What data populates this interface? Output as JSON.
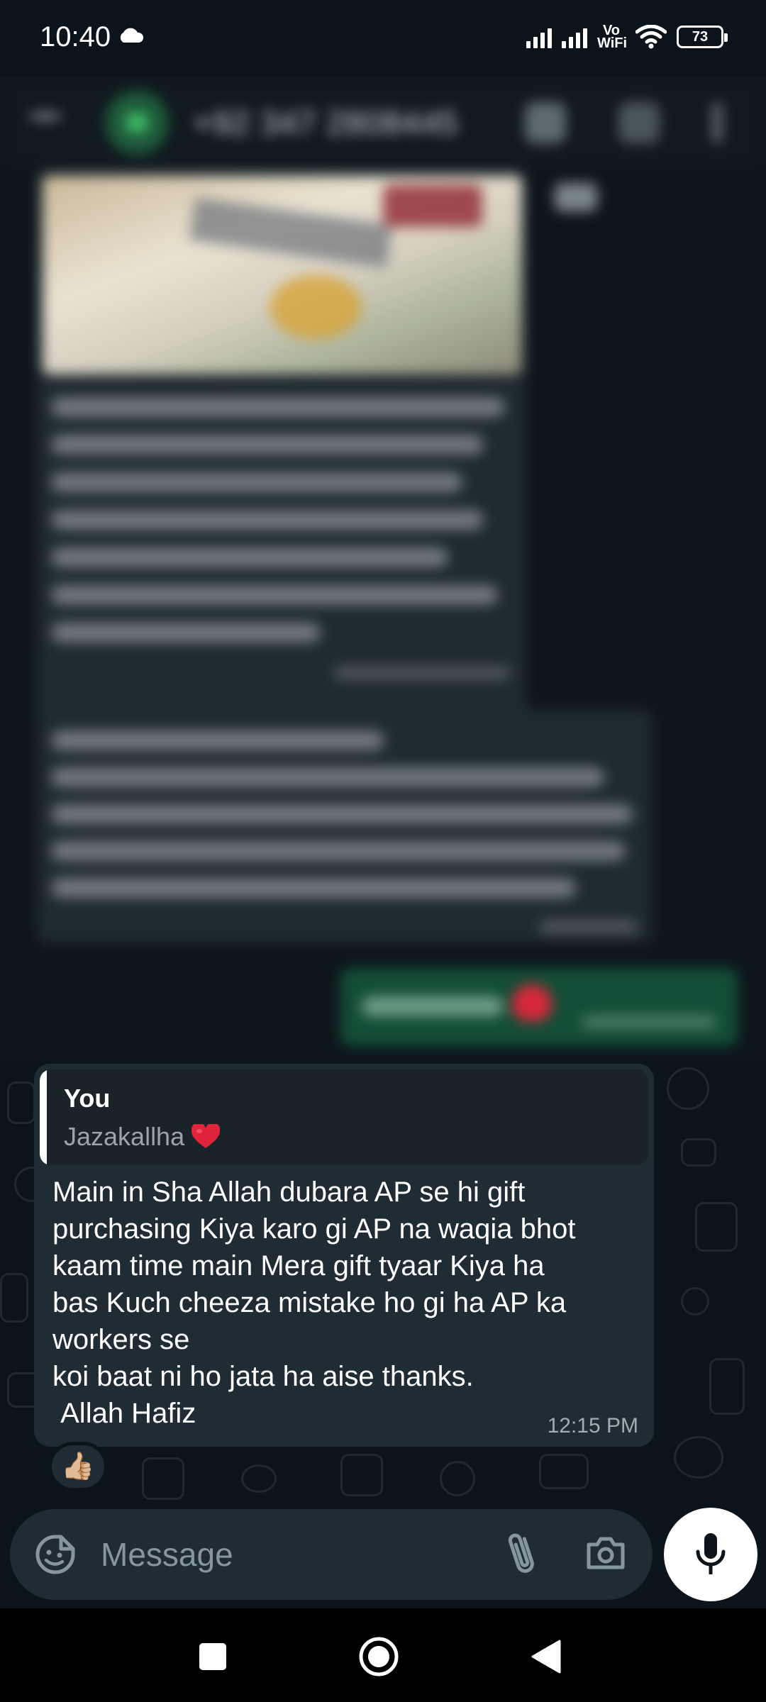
{
  "status_bar": {
    "time": "10:40",
    "network_label": "Vo WiFi",
    "battery": "73"
  },
  "header_blurred": {
    "contact": "+92 347 2808445"
  },
  "focused_message": {
    "quoted_author": "You",
    "quoted_text": "Jazakallha",
    "text": "Main in Sha Allah dubara AP se hi gift\npurchasing Kiya karo gi AP na waqia bhot\nkaam time main Mera gift tyaar Kiya ha\nbas Kuch cheeza mistake ho gi ha AP ka\nworkers se\nkoi baat ni ho jata ha aise thanks.\n Allah Hafiz",
    "time": "12:15 PM",
    "reaction": "👍🏼"
  },
  "composer": {
    "placeholder": "Message"
  },
  "colors": {
    "background": "#0b141a",
    "bubble_incoming": "#202c33",
    "bubble_outgoing": "#144d37",
    "accent": "#25d366"
  },
  "icons": {
    "status": [
      "cloud-icon",
      "signal-icon",
      "wifi-icon",
      "battery-icon"
    ],
    "composer": [
      "sticker-icon",
      "attach-icon",
      "camera-icon",
      "mic-icon"
    ],
    "nav": [
      "recents-icon",
      "home-icon",
      "back-icon"
    ]
  }
}
